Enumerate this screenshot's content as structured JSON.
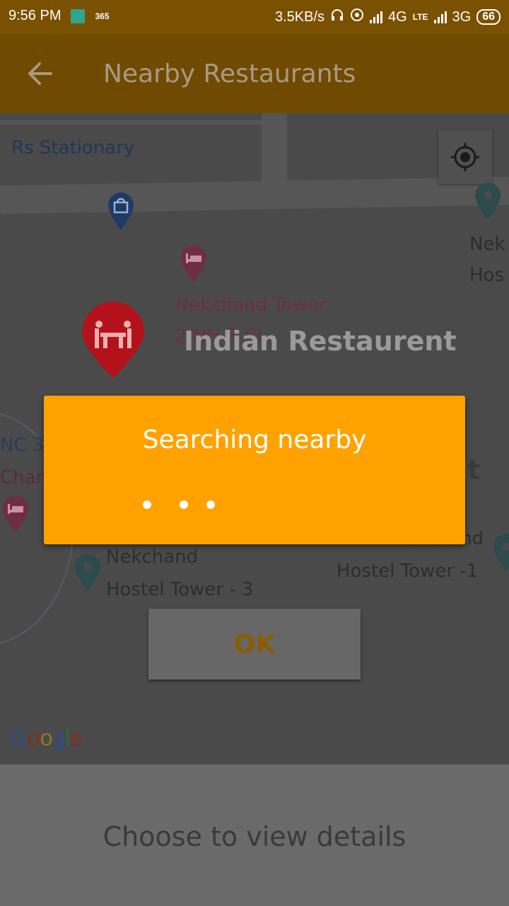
{
  "status_bar": {
    "time": "9:56 PM",
    "badge": "365",
    "speed": "3.5KB/s",
    "network1": "4G",
    "volte": "LTE",
    "network2": "3G",
    "battery": "66"
  },
  "appbar": {
    "title": "Nearby Restaurants",
    "back_icon": "arrow-left-icon"
  },
  "map": {
    "labels": {
      "stationary": "Rs Stationary",
      "nekchand_tower": "Nekchand Tower",
      "nekchand_tower_sub": "2/NH 3 Cl",
      "indian_restaurant": "Indian Restaurent",
      "nc3": "NC 3",
      "char": "Char",
      "nek_right": "Nek",
      "hos_right": "Hos",
      "nt_partial": "nt",
      "hostel3_line1": "Nekchand",
      "hostel3_line2": "Hostel Tower - 3",
      "hostel1_line1": "Nekchand",
      "hostel1_line2": "Hostel Tower -1"
    },
    "google_logo": "Google",
    "locate_icon": "my-location-icon",
    "colors": {
      "background": "#4a4a4a",
      "restaurant_pin": "#b3121a",
      "hotel_pin": "#6d2e43",
      "shop_pin": "#1e3a66",
      "poi_pin": "#2d4a4d"
    }
  },
  "dialog": {
    "message": "Searching nearby",
    "loading_dots": 3,
    "background": "#ffa200"
  },
  "ok_button": {
    "label": "OK"
  },
  "bottom_sheet": {
    "text": "Choose to view details"
  }
}
